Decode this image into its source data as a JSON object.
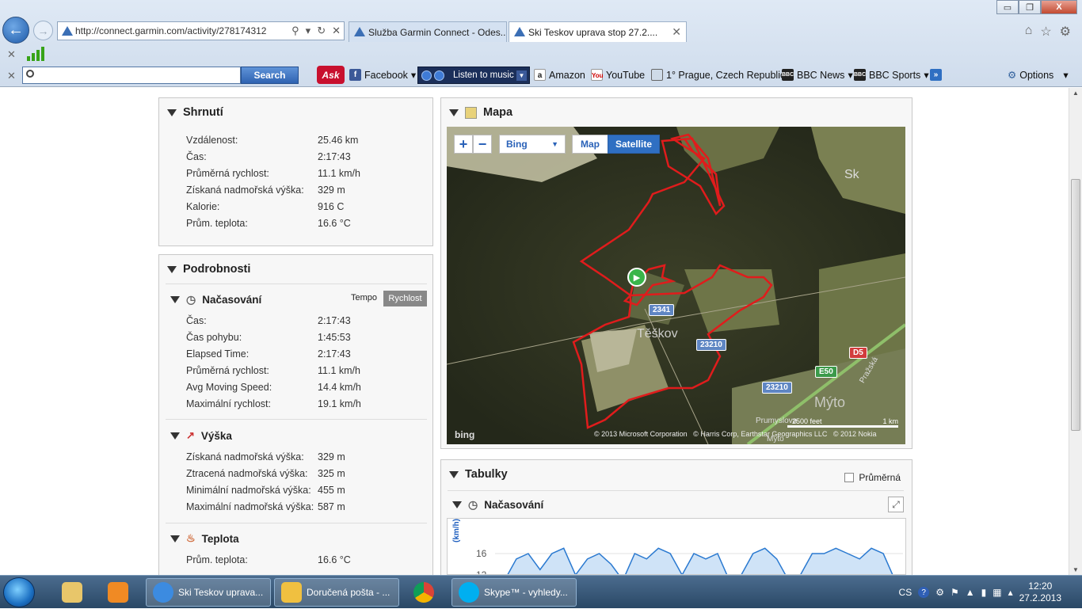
{
  "browser": {
    "url": "http://connect.garmin.com/activity/278174312",
    "tabs": [
      {
        "label": "Služba Garmin Connect - Odes..."
      },
      {
        "label": "Ski Teskov uprava stop 27.2...."
      }
    ],
    "window_controls": {
      "minimize": "▭",
      "maximize": "❐",
      "close": "X"
    }
  },
  "toolbar": {
    "search_button": "Search",
    "ask": "Ask",
    "links": [
      {
        "label": "Facebook",
        "icon": "facebook-icon"
      },
      {
        "label": "Listen to music",
        "icon": "music-player-icon"
      },
      {
        "label": "Amazon",
        "icon": "amazon-icon"
      },
      {
        "label": "YouTube",
        "icon": "youtube-icon"
      },
      {
        "label": "1° Prague, Czech Republic",
        "icon": "weather-icon"
      },
      {
        "label": "BBC News",
        "icon": "bbc-icon"
      },
      {
        "label": "BBC Sports",
        "icon": "bbc-icon"
      },
      {
        "label": "»",
        "icon": "more-icon"
      }
    ],
    "options": "Options"
  },
  "summary": {
    "title": "Shrnutí",
    "rows": [
      {
        "label": "Vzdálenost:",
        "value": "25.46 km"
      },
      {
        "label": "Čas:",
        "value": "2:17:43"
      },
      {
        "label": "Průměrná rychlost:",
        "value": "11.1 km/h"
      },
      {
        "label": "Získaná nadmořská výška:",
        "value": "329 m"
      },
      {
        "label": "Kalorie:",
        "value": "916 C"
      },
      {
        "label": "Prům. teplota:",
        "value": "16.6 °C"
      }
    ]
  },
  "details": {
    "title": "Podrobnosti",
    "timing": {
      "title": "Načasování",
      "tempo": "Tempo",
      "speed": "Rychlost",
      "rows": [
        {
          "label": "Čas:",
          "value": "2:17:43"
        },
        {
          "label": "Čas pohybu:",
          "value": "1:45:53"
        },
        {
          "label": "Elapsed Time:",
          "value": "2:17:43"
        },
        {
          "label": "Průměrná rychlost:",
          "value": "11.1 km/h"
        },
        {
          "label": "Avg Moving Speed:",
          "value": "14.4 km/h"
        },
        {
          "label": "Maximální rychlost:",
          "value": "19.1 km/h"
        }
      ]
    },
    "elevation": {
      "title": "Výška",
      "rows": [
        {
          "label": "Získaná nadmořská výška:",
          "value": "329 m"
        },
        {
          "label": "Ztracená nadmořská výška:",
          "value": "325 m"
        },
        {
          "label": "Minimální nadmořská výška:",
          "value": "455 m"
        },
        {
          "label": "Maximální nadmořská výška:",
          "value": "587 m"
        }
      ]
    },
    "temperature": {
      "title": "Teplota",
      "rows": [
        {
          "label": "Prům. teplota:",
          "value": "16.6 °C"
        }
      ]
    }
  },
  "map": {
    "title": "Mapa",
    "provider": "Bing",
    "view_map": "Map",
    "view_satellite": "Satellite",
    "active_view": "Satellite",
    "labels": {
      "town": "Těškov",
      "sk": "Sk",
      "myto": "Mýto",
      "myto_small": "Myto",
      "prumyslova": "Prumyslova",
      "prazska": "Pražská"
    },
    "roads": [
      "2341",
      "23210",
      "23210",
      "D5",
      "E50"
    ],
    "scale": {
      "feet": "2500 feet",
      "km": "1 km"
    },
    "copyright": "© 2013 Microsoft Corporation   © Harris Corp, Earthstar Geographics LLC   © 2012 Nokia",
    "logo": "bing",
    "colors": {
      "route": "#e01c1c",
      "map_active": "#2f6fc2"
    }
  },
  "tables": {
    "title": "Tabulky",
    "average_label": "Průměrná",
    "average_checked": false,
    "timing_title": "Načasování",
    "chart_ylabel": "(km/h)",
    "chart_ticks": [
      "16",
      "12"
    ]
  },
  "chart_data": {
    "type": "area",
    "title": "Načasování",
    "ylabel": "(km/h)",
    "ylim": [
      12,
      18
    ],
    "series": [
      {
        "values": [
          11,
          15,
          16,
          13,
          16,
          17,
          12,
          15,
          16,
          14,
          11,
          16,
          15,
          17,
          16,
          12,
          16,
          15,
          16,
          11,
          12,
          16,
          17,
          15,
          11,
          12,
          16,
          16,
          17,
          16,
          15,
          17,
          16,
          11
        ]
      }
    ]
  },
  "taskbar": {
    "items": [
      {
        "label": "Ski Teskov uprava...",
        "icon": "internet-explorer-icon"
      },
      {
        "label": "Doručená pošta - ...",
        "icon": "mail-icon"
      },
      {
        "label": "",
        "icon": "chrome-icon"
      },
      {
        "label": "Skype™ - vyhledy...",
        "icon": "skype-icon"
      }
    ],
    "lang": "CS",
    "time": "12:20",
    "date": "27.2.2013"
  }
}
